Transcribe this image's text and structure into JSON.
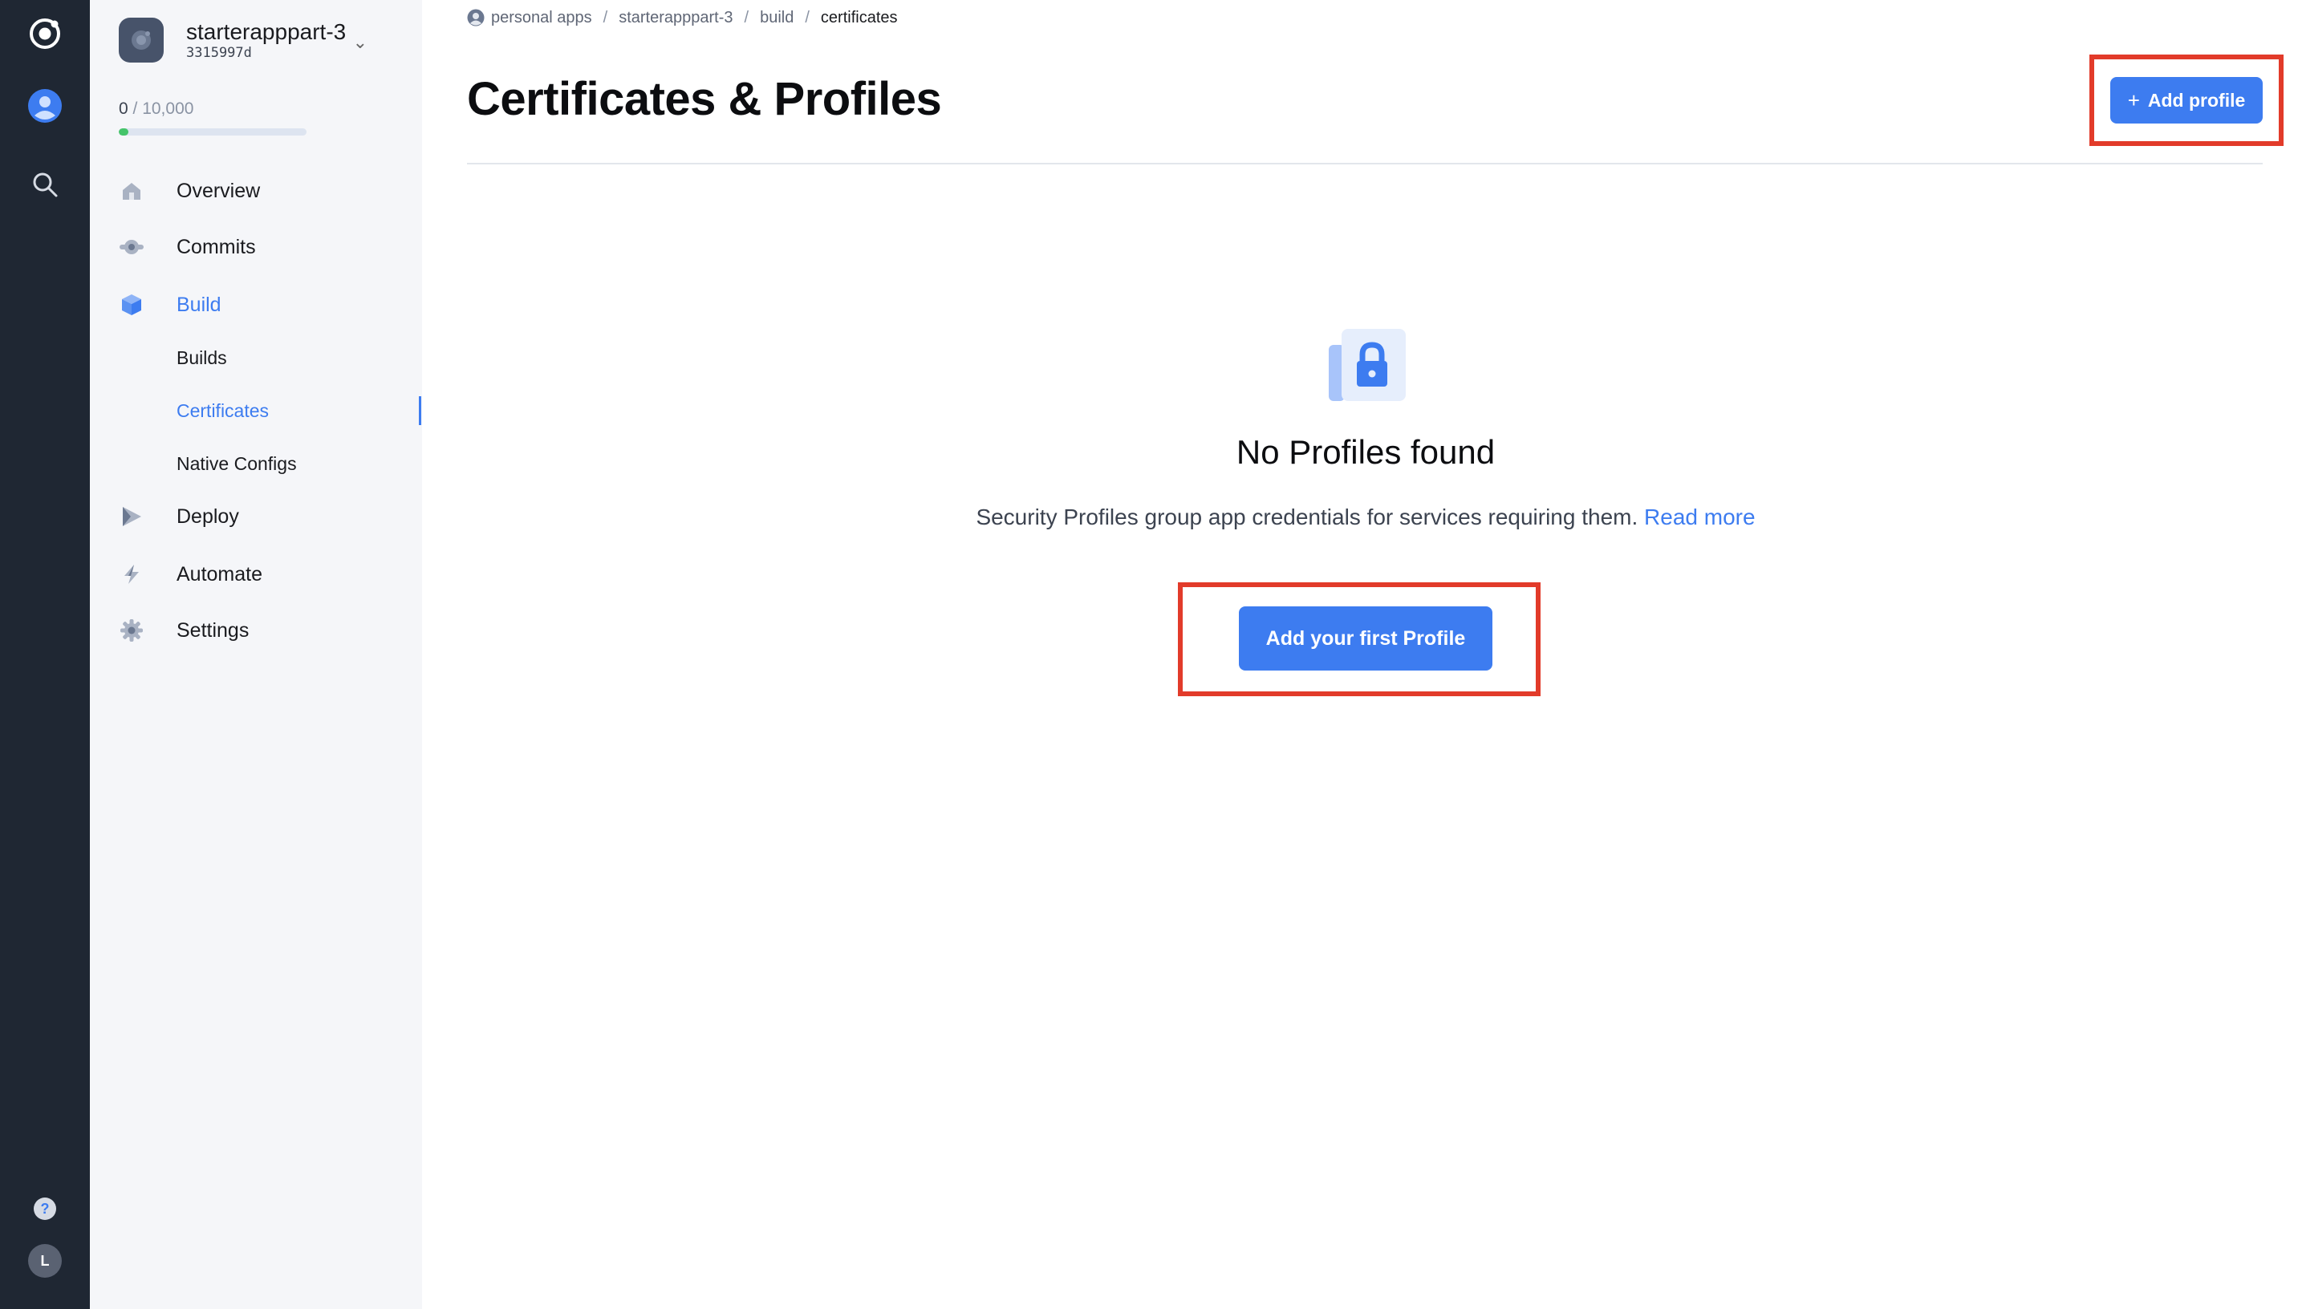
{
  "app": {
    "name": "starterapppart-3",
    "id": "3315997d"
  },
  "usage": {
    "used": "0",
    "limit": "/ 10,000",
    "fraction": 0.05,
    "bar_color": "#45c46a"
  },
  "nav": {
    "items": [
      {
        "label": "Overview",
        "icon": "home-icon"
      },
      {
        "label": "Commits",
        "icon": "commit-icon"
      },
      {
        "label": "Build",
        "icon": "cube-icon",
        "active": true
      },
      {
        "label": "Deploy",
        "icon": "deploy-icon"
      },
      {
        "label": "Automate",
        "icon": "bolt-icon"
      },
      {
        "label": "Settings",
        "icon": "gear-icon"
      }
    ],
    "build_sub": [
      {
        "label": "Builds"
      },
      {
        "label": "Certificates",
        "active": true
      },
      {
        "label": "Native Configs"
      }
    ]
  },
  "rail": {
    "user_initial": "L",
    "help": "?"
  },
  "breadcrumb": {
    "items": [
      "personal apps",
      "starterapppart-3",
      "build",
      "certificates"
    ],
    "separator": "/"
  },
  "header": {
    "title": "Certificates & Profiles",
    "add_button": "Add profile",
    "add_button_icon": "+"
  },
  "empty_state": {
    "icon": "lock-document-icon",
    "title": "No Profiles found",
    "description": "Security Profiles group app credentials for services requiring them.",
    "link": "Read more",
    "button": "Add your first Profile"
  },
  "colors": {
    "accent": "#3d7cf0",
    "rail": "#1f2733",
    "sidebar": "#f5f6f9",
    "highlight": "#e23b2a"
  }
}
